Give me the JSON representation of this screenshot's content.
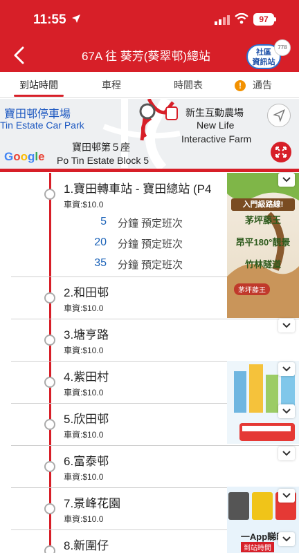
{
  "status_bar": {
    "time": "11:55",
    "battery": "97"
  },
  "header": {
    "title": "67A 往 葵芳(葵翠邨)總站",
    "community_label_1": "社區",
    "community_label_2": "資訊站",
    "community_badge": "778"
  },
  "tabs": [
    {
      "label": "到站時間",
      "active": true
    },
    {
      "label": "車程",
      "active": false
    },
    {
      "label": "時間表",
      "active": false
    },
    {
      "label": "通告",
      "active": false
    }
  ],
  "map": {
    "carpark_zh": "寶田邨停車場",
    "carpark_en": "Tin Estate Car Park",
    "farm_zh": "新生互動農場",
    "farm_en_1": "New Life",
    "farm_en_2": "Interactive Farm",
    "block_zh": "寶田邨第５座",
    "block_en": "Po Tin Estate Block 5",
    "google": "Google"
  },
  "stops": [
    {
      "name": "1.寶田轉車站 - 寶田總站 (P4",
      "fare": "車資:$10.0",
      "etas": [
        {
          "minutes": "5",
          "unit": "分鐘",
          "note": "預定班次"
        },
        {
          "minutes": "20",
          "unit": "分鐘",
          "note": "預定班次"
        },
        {
          "minutes": "35",
          "unit": "分鐘",
          "note": "預定班次"
        }
      ]
    },
    {
      "name": "2.和田邨",
      "fare": "車資:$10.0"
    },
    {
      "name": "3.塘亨路",
      "fare": "車資:$10.0"
    },
    {
      "name": "4.紫田村",
      "fare": "車資:$10.0"
    },
    {
      "name": "5.欣田邨",
      "fare": "車資:$10.0"
    },
    {
      "name": "6.富泰邨",
      "fare": "車資:$10.0"
    },
    {
      "name": "7.景峰花園",
      "fare": "車資:$10.0"
    },
    {
      "name": "8.新圍仔",
      "fare": ""
    }
  ],
  "ads": {
    "ad1_heading": "入門級路線!",
    "ad1_line1": "茅坪藤王",
    "ad1_line2": "昂平180°靚景",
    "ad1_line3": "竹林隧道",
    "ad1_tag": "茅坪藤王",
    "ad3_text": "一App睇晒",
    "ad3_sub": "到站時間"
  },
  "colors": {
    "brand_red": "#d71f28",
    "eta_blue": "#1a62b8"
  }
}
